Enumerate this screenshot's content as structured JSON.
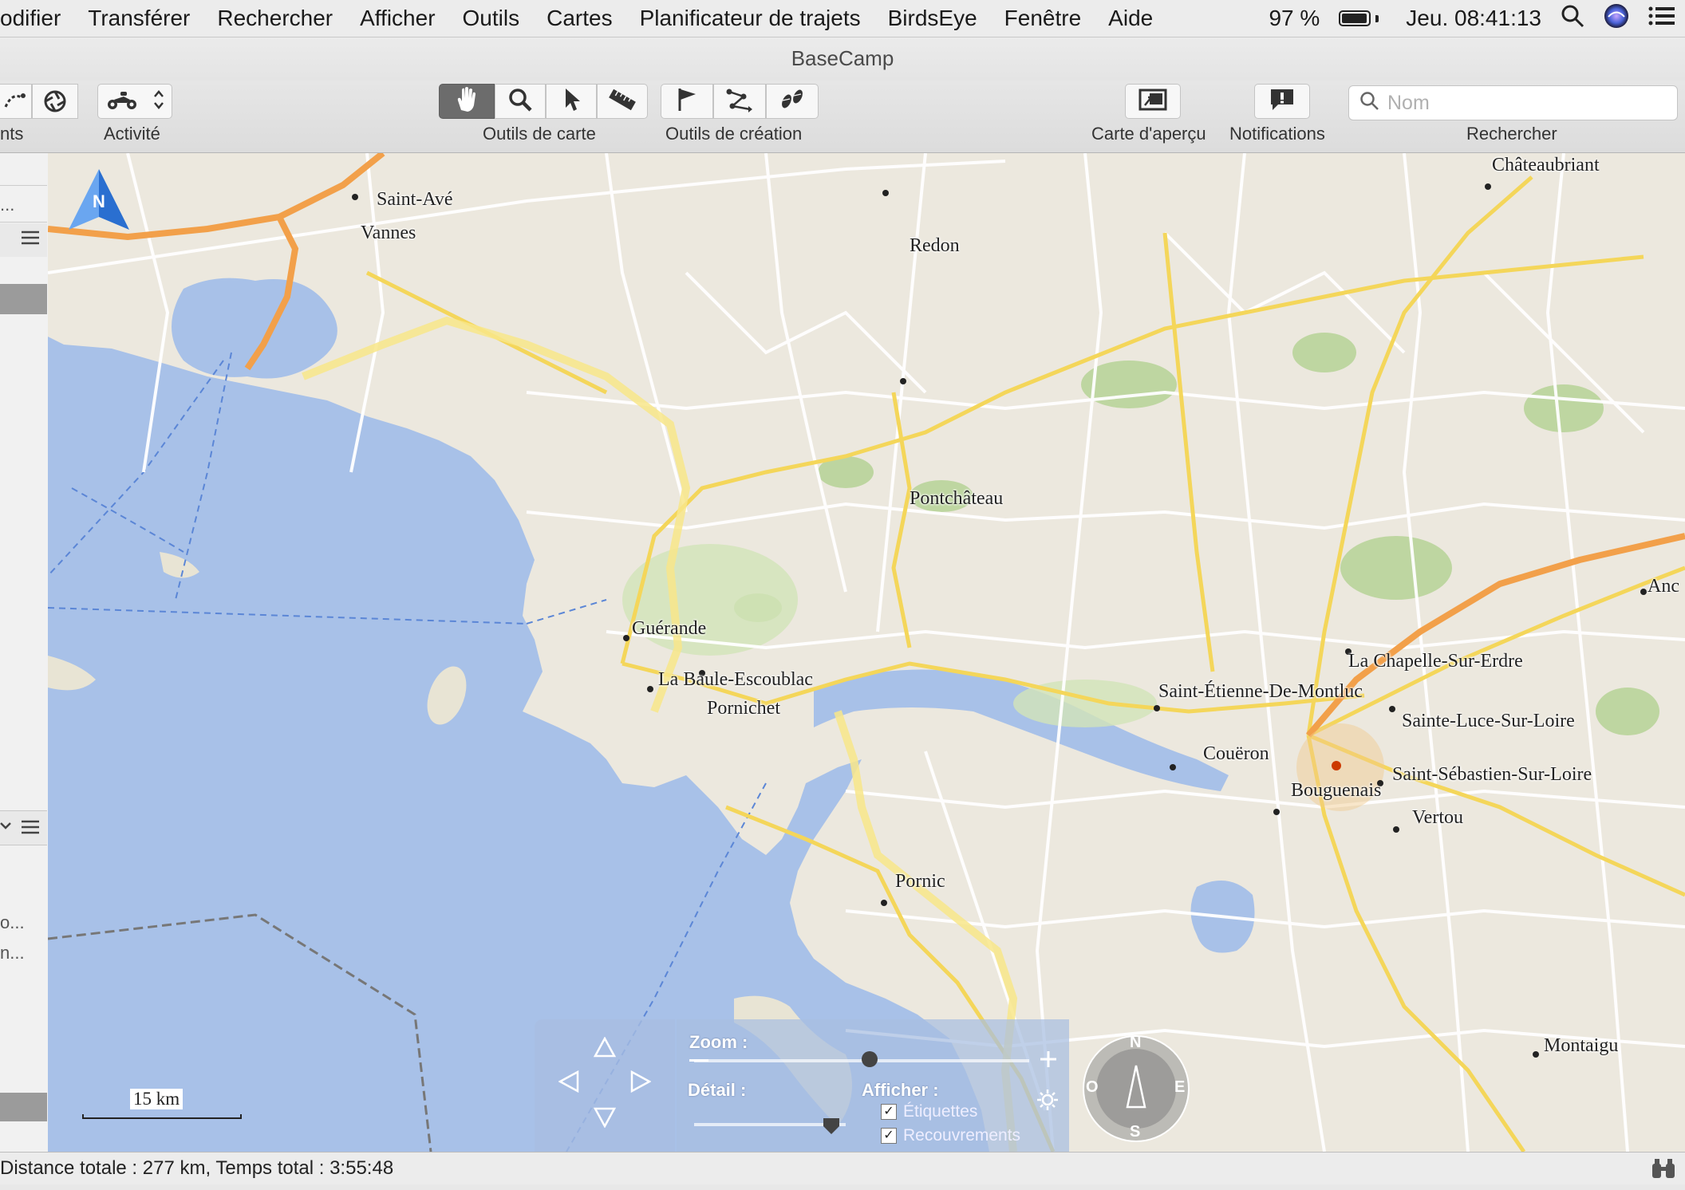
{
  "menubar": {
    "items": [
      "odifier",
      "Transférer",
      "Rechercher",
      "Afficher",
      "Outils",
      "Cartes",
      "Planificateur de trajets",
      "BirdsEye",
      "Fenêtre",
      "Aide"
    ],
    "battery_percent": "97 %",
    "battery_level": 0.97,
    "clock": "Jeu. 08:41:13"
  },
  "window": {
    "title": "BaseCamp"
  },
  "toolbar": {
    "partial_label": "nts",
    "activity_label": "Activité",
    "map_tools_label": "Outils de carte",
    "creation_tools_label": "Outils de création",
    "overview_label": "Carte d'aperçu",
    "notifications_label": "Notifications",
    "search_label": "Rechercher",
    "search_placeholder": "Nom"
  },
  "sidebar": {
    "rows": [
      "...",
      "o...",
      "n..."
    ]
  },
  "map": {
    "places": [
      {
        "name": "Châteaubriant"
      },
      {
        "name": "Saint-Avé"
      },
      {
        "name": "Vannes"
      },
      {
        "name": "Redon"
      },
      {
        "name": "Pontchâteau"
      },
      {
        "name": "Guérande"
      },
      {
        "name": "La Baule-Escoublac"
      },
      {
        "name": "Pornichet"
      },
      {
        "name": "La Chapelle-Sur-Erdre"
      },
      {
        "name": "Saint-Étienne-De-Montluc"
      },
      {
        "name": "Sainte-Luce-Sur-Loire"
      },
      {
        "name": "Couëron"
      },
      {
        "name": "Saint-Sébastien-Sur-Loire"
      },
      {
        "name": "Bouguenais"
      },
      {
        "name": "Vertou"
      },
      {
        "name": "Pornic"
      },
      {
        "name": "Montaigu"
      },
      {
        "name": "Anc"
      }
    ],
    "north_label": "N",
    "scale_label": "15 km",
    "colors": {
      "sea": "#a8c1e8",
      "land": "#ece8de",
      "motorway": "#f2a04a",
      "major_road": "#f4d65a",
      "minor_road": "#ffffff",
      "forest": "#b9d49a"
    }
  },
  "map_controls": {
    "zoom_label": "Zoom :",
    "detail_label": "Détail :",
    "show_label": "Afficher :",
    "labels_option": "Étiquettes",
    "overlays_option": "Recouvrements",
    "labels_checked": true,
    "overlays_checked": true,
    "compass": {
      "n": "N",
      "e": "E",
      "s": "S",
      "o": "O"
    }
  },
  "statusbar": {
    "text": "Distance totale : 277 km, Temps total : 3:55:48"
  }
}
